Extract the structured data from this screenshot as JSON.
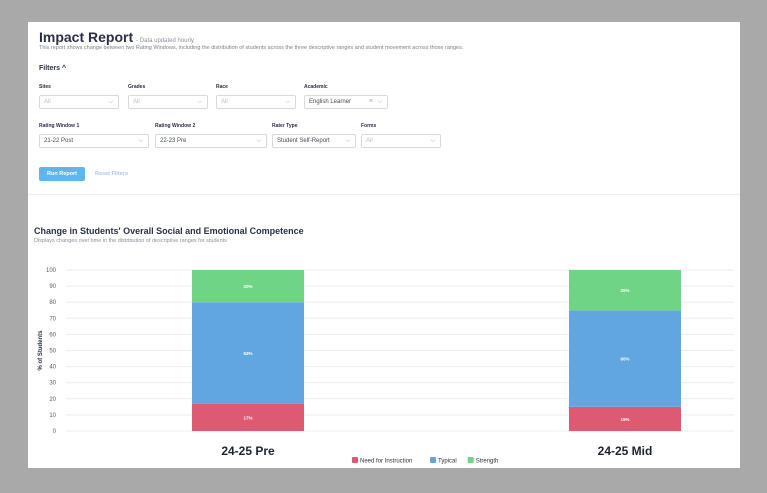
{
  "report": {
    "title": "Impact Report",
    "subtitle": "- Data updated hourly",
    "description": "This report shows change between two Rating Windows, including the distribution of students across the three descriptive ranges and student movement across those ranges."
  },
  "filters": {
    "heading": "Filters ^",
    "row1": [
      {
        "label": "Sites",
        "value": "All"
      },
      {
        "label": "Grades",
        "value": "All"
      },
      {
        "label": "Race",
        "value": "All"
      },
      {
        "label": "Academic",
        "value": "English Learner"
      }
    ],
    "row2": [
      {
        "label": "Rating Window 1",
        "value": "21-22 Post"
      },
      {
        "label": "Rating Window 2",
        "value": "22-23 Pre"
      },
      {
        "label": "Rater Type",
        "value": "Student Self-Report"
      },
      {
        "label": "Forms",
        "value": "All"
      }
    ],
    "run_label": "Run Report",
    "reset_label": "Reset Filters"
  },
  "chart": {
    "title": "Change in Students' Overall Social and Emotional Competence",
    "subtitle": "Displays changes over time in the distribution of descriptive ranges for students"
  },
  "colors": {
    "need": "#de5a73",
    "typical": "#62a6e0",
    "strength": "#6fd585"
  },
  "chart_data": {
    "type": "bar",
    "stacked": true,
    "categories": [
      "24-25 Pre",
      "24-25 Mid"
    ],
    "series": [
      {
        "name": "Need for Instruction",
        "values": [
          17,
          15
        ],
        "labels": [
          "17%",
          "15%"
        ]
      },
      {
        "name": "Typical",
        "values": [
          63,
          60
        ],
        "labels": [
          "63%",
          "60%"
        ]
      },
      {
        "name": "Strength",
        "values": [
          20,
          25
        ],
        "labels": [
          "20%",
          "25%"
        ]
      }
    ],
    "ylabel": "% of Students",
    "ylim": [
      0,
      100
    ],
    "yticks": [
      "0",
      "10",
      "20",
      "30",
      "40",
      "50",
      "60",
      "70",
      "80",
      "90",
      "100"
    ],
    "grid": true,
    "legend": "bottom-center"
  }
}
